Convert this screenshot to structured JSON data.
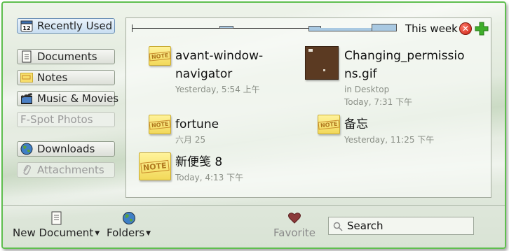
{
  "sidebar": {
    "items": [
      {
        "label": "Recently Used",
        "icon": "calendar-icon",
        "active": true
      },
      {
        "label": "Documents",
        "icon": "document-icon"
      },
      {
        "label": "Notes",
        "icon": "note-icon"
      },
      {
        "label": "Music & Movies",
        "icon": "film-icon"
      },
      {
        "label": "F-Spot Photos",
        "icon": "",
        "disabled": true
      },
      {
        "label": "Downloads",
        "icon": "globe-icon"
      },
      {
        "label": "Attachments",
        "icon": "paperclip-icon",
        "disabled": true
      }
    ],
    "calendar_day": "12"
  },
  "timeline": {
    "label": "This week"
  },
  "items": [
    {
      "name_line1": "avant-window-",
      "name_line2": "navigator",
      "meta_line1": "Yesterday,  5:54 上午",
      "icon": "note-icon",
      "icon_text": "NOTE"
    },
    {
      "name_line1": "Changing_permissio",
      "name_line2": "ns.gif",
      "meta_line1": "in Desktop",
      "meta_line2": "Today,  7:31 下午",
      "icon": "image-thumbnail"
    },
    {
      "name_line1": "fortune",
      "meta_line1": "六月 25",
      "icon": "note-icon",
      "icon_text": "NOTE"
    },
    {
      "name_line1": "备忘",
      "meta_line1": "Yesterday, 11:25 下午",
      "icon": "note-icon",
      "icon_text": "NOTE"
    },
    {
      "name_line1": "新便笺 8",
      "meta_line1": "Today,  4:13 下午",
      "icon": "note-icon",
      "icon_text": "NOTE"
    }
  ],
  "toolbar": {
    "new_document": "New Document",
    "folders": "Folders",
    "favorite": "Favorite",
    "search_placeholder": "Search"
  },
  "colors": {
    "accent_border": "#5fbf4f",
    "timeline_bar": "#a9c9e2"
  }
}
